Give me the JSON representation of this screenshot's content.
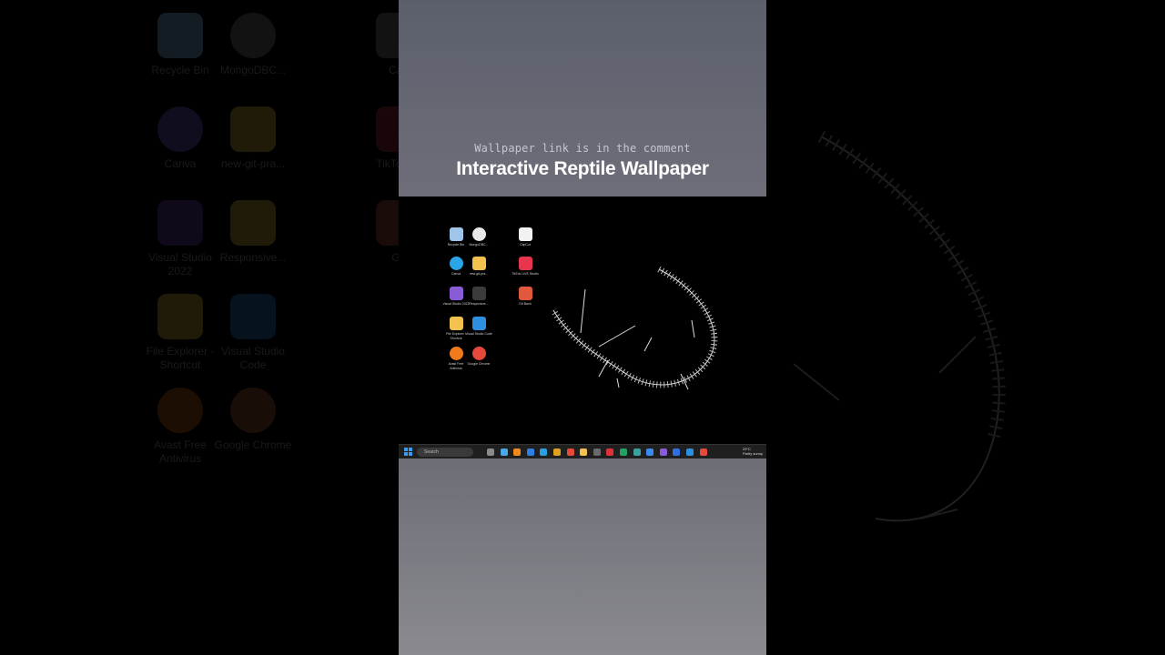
{
  "overlay": {
    "subtitle": "Wallpaper link is in the comment",
    "title": "Interactive Reptile Wallpaper"
  },
  "background_icons": [
    {
      "label": "Recycle Bin",
      "icon": "recycle-bin-icon"
    },
    {
      "label": "MongoDBC...",
      "icon": "mongodb-icon"
    },
    {
      "label": "Cap",
      "icon": "capcut-icon"
    },
    {
      "label": "Canva",
      "icon": "canva-icon"
    },
    {
      "label": "new-git-pra...",
      "icon": "folder-icon"
    },
    {
      "label": "TikTo Stu",
      "icon": "tiktok-icon"
    },
    {
      "label": "Visual Studio 2022",
      "icon": "visual-studio-icon"
    },
    {
      "label": "Responsive...",
      "icon": "folder-icon"
    },
    {
      "label": "Git",
      "icon": "git-icon"
    },
    {
      "label": "File Explorer - Shortcut",
      "icon": "file-explorer-icon"
    },
    {
      "label": "Visual Studio Code",
      "icon": "vscode-icon"
    },
    {
      "label": "Avast Free Antivirus",
      "icon": "avast-icon"
    },
    {
      "label": "Google Chrome",
      "icon": "chrome-icon"
    }
  ],
  "desktop_icons": [
    {
      "label": "Recycle Bin",
      "icon": "recycle-bin-icon",
      "color": "#9fc6ea"
    },
    {
      "label": "MongoDBC...",
      "icon": "mongodb-icon",
      "color": "#e8e8e8"
    },
    {
      "label": "CapCut",
      "icon": "capcut-icon",
      "color": "#f2f2f2"
    },
    {
      "label": "Canva",
      "icon": "canva-icon",
      "color": "#2aa5e8"
    },
    {
      "label": "new-git-pra...",
      "icon": "folder-icon",
      "color": "#f2c14e"
    },
    {
      "label": "TikTok LIVE Studio",
      "icon": "tiktok-icon",
      "color": "#e8344c"
    },
    {
      "label": "Visual Studio 2022",
      "icon": "visual-studio-icon",
      "color": "#8a5bd6"
    },
    {
      "label": "Responsive...",
      "icon": "folder-icon",
      "color": "#3b3b3b"
    },
    {
      "label": "Git Bash",
      "icon": "git-icon",
      "color": "#e0593c"
    },
    {
      "label": "File Explorer - Shortcut",
      "icon": "file-explorer-icon",
      "color": "#f2c14e"
    },
    {
      "label": "Visual Studio Code",
      "icon": "vscode-icon",
      "color": "#2c8fe0"
    },
    {
      "label": "Avast Free Antivirus",
      "icon": "avast-icon",
      "color": "#f07a1c"
    },
    {
      "label": "Google Chrome",
      "icon": "chrome-icon",
      "color": "#e5493a"
    }
  ],
  "taskbar": {
    "search_placeholder": "Search",
    "weather": "29°C",
    "weather_desc": "Partly sunny",
    "apps": [
      {
        "icon": "file-icon",
        "color": "#8a8a8a"
      },
      {
        "icon": "copilot-icon",
        "color": "#4aa8e8"
      },
      {
        "icon": "vlc-icon",
        "color": "#f08a1c"
      },
      {
        "icon": "store-icon",
        "color": "#2f7fe0"
      },
      {
        "icon": "edge-icon",
        "color": "#2aa0e0"
      },
      {
        "icon": "app-icon",
        "color": "#e0a020"
      },
      {
        "icon": "chrome-icon",
        "color": "#e5493a"
      },
      {
        "icon": "folder-icon",
        "color": "#f2c14e"
      },
      {
        "icon": "media-icon",
        "color": "#6a6a6a"
      },
      {
        "icon": "opera-icon",
        "color": "#e0303a"
      },
      {
        "icon": "excel-icon",
        "color": "#21a366"
      },
      {
        "icon": "app-icon",
        "color": "#3aa0a0"
      },
      {
        "icon": "messenger-icon",
        "color": "#3a8af0"
      },
      {
        "icon": "visual-studio-icon",
        "color": "#8a5bd6"
      },
      {
        "icon": "facebook-icon",
        "color": "#2f6fe0"
      },
      {
        "icon": "vscode-icon",
        "color": "#2c8fe0"
      },
      {
        "icon": "chrome-icon",
        "color": "#e5493a"
      }
    ]
  }
}
